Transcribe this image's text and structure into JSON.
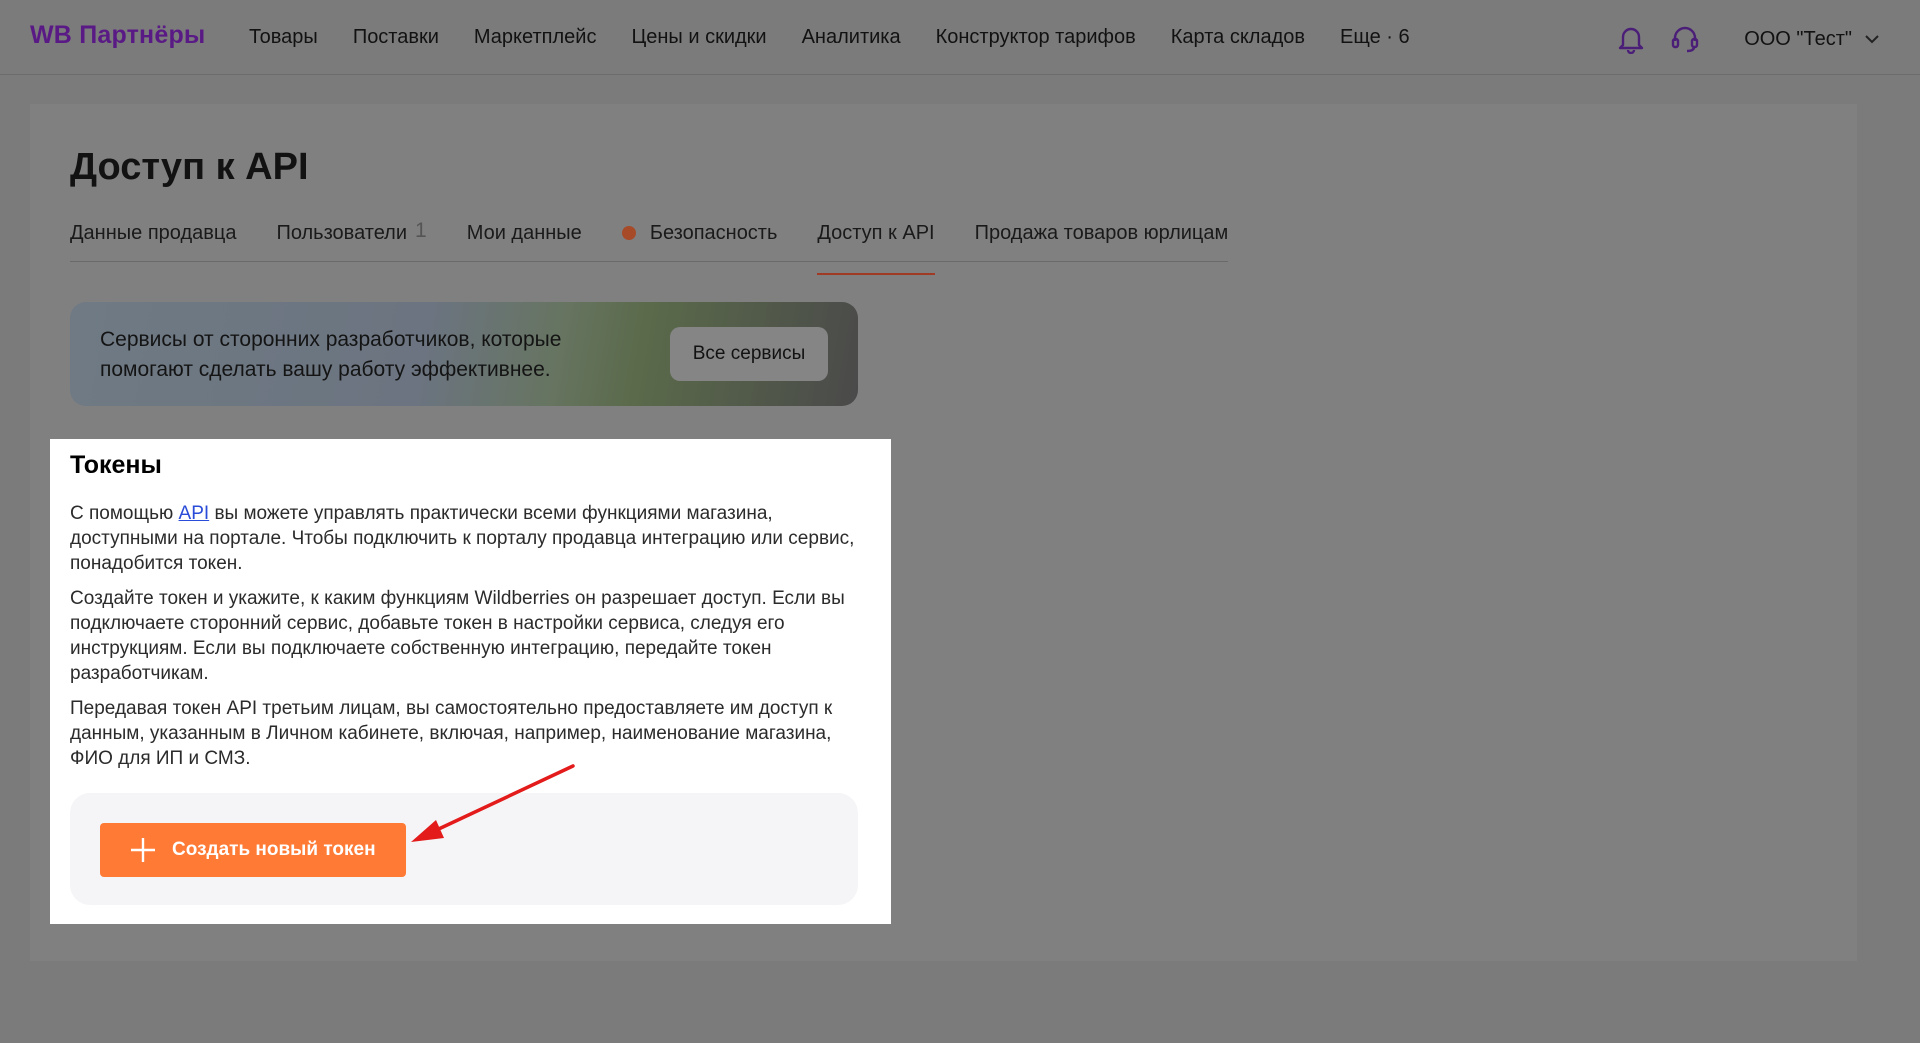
{
  "brand": {
    "logo": "WB Партнёры",
    "accent": "#5a1a85",
    "action": "#ff7a35"
  },
  "nav": {
    "items": [
      "Товары",
      "Поставки",
      "Маркетплейс",
      "Цены и скидки",
      "Аналитика",
      "Конструктор тарифов",
      "Карта складов",
      "Еще · 6"
    ]
  },
  "header": {
    "org_name": "ООО \"Тест\"",
    "icons": [
      "bell-icon",
      "headset-icon",
      "chevron-down-icon"
    ]
  },
  "page": {
    "title": "Доступ к API"
  },
  "tabs": [
    {
      "label": "Данные продавца"
    },
    {
      "label": "Пользователи",
      "count": "1"
    },
    {
      "label": "Мои данные"
    },
    {
      "label": "Безопасность",
      "alert_dot": true
    },
    {
      "label": "Доступ к API",
      "active": true
    },
    {
      "label": "Продажа товаров юрлицам"
    }
  ],
  "banner": {
    "text": "Сервисы от сторонних разработчиков, которые помогают сделать вашу работу эффективнее.",
    "button": "Все сервисы"
  },
  "tokens": {
    "title": "Токены",
    "p1_before": "С помощью ",
    "p1_link": "API",
    "p1_after": " вы можете управлять практически всеми функциями магазина, доступными на портале. Чтобы подключить к порталу продавца интеграцию или сервис, понадобится токен.",
    "p2": "Создайте токен и укажите, к каким функциям Wildberries он разрешает доступ. Если вы подключаете сторонний сервис, добавьте токен в настройки сервиса, следуя его инструкциям. Если вы подключаете собственную интеграцию, передайте токен разработчикам.",
    "p3": "Передавая токен API третьим лицам, вы самостоятельно предоставляете им доступ к данным, указанным в Личном кабинете, включая, например, наименование магазина, ФИО для ИП и СМЗ.",
    "create_button": "Создать новый токен"
  }
}
